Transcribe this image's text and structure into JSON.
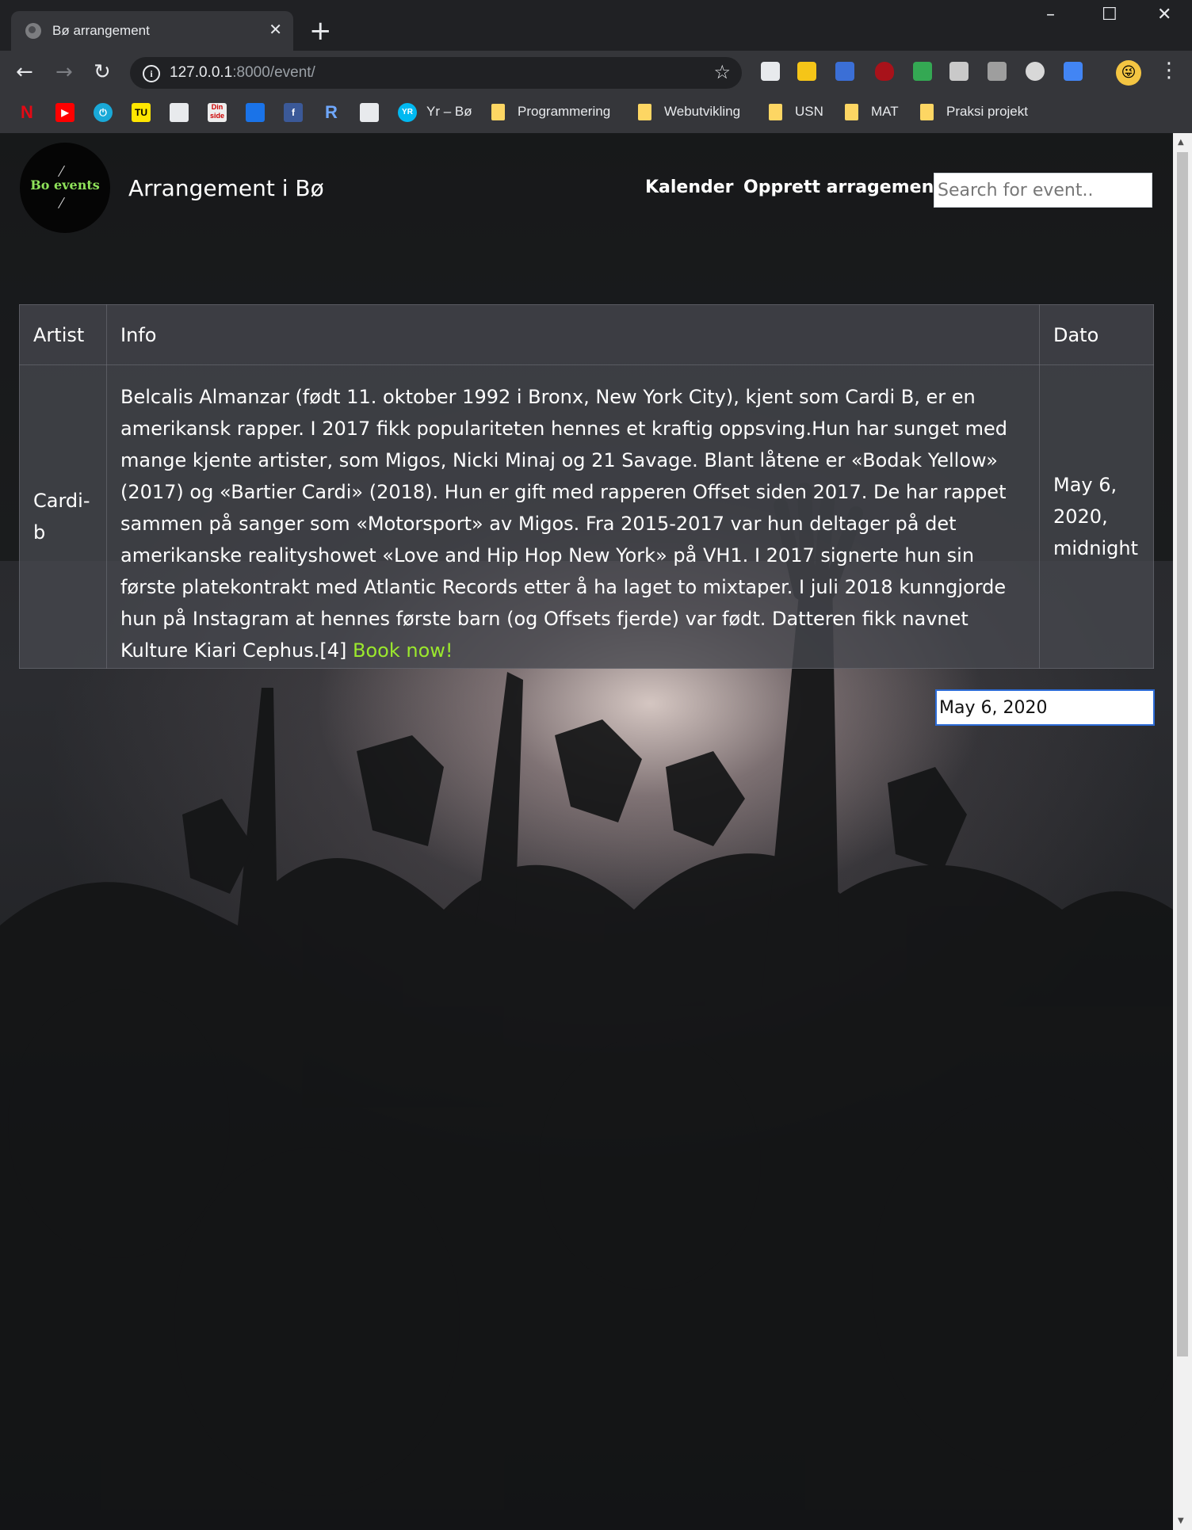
{
  "browser": {
    "tab_title": "Bø arrangement",
    "url_host": "127.0.0.1",
    "url_rest": ":8000/event/",
    "bookmarks": [
      {
        "label": "Yr – Bø"
      },
      {
        "label": "Programmering"
      },
      {
        "label": "Webutvikling"
      },
      {
        "label": "USN"
      },
      {
        "label": "MAT"
      },
      {
        "label": "Praksi projekt"
      }
    ]
  },
  "site": {
    "logo_text": "Bo events",
    "title": "Arrangement i Bø",
    "nav": {
      "calendar": "Kalender",
      "create": "Opprett arragement"
    },
    "search": {
      "placeholder": "Search for event.."
    }
  },
  "table": {
    "headers": {
      "artist": "Artist",
      "info": "Info",
      "date": "Dato"
    },
    "rows": [
      {
        "artist": "Cardi-b",
        "info": "Belcalis Almanzar (født 11. oktober 1992 i Bronx, New York City), kjent som Cardi B, er en amerikansk rapper. I 2017 fikk populariteten hennes et kraftig oppsving.Hun har sunget med mange kjente artister, som Migos, Nicki Minaj og 21 Savage. Blant låtene er «Bodak Yellow» (2017) og «Bartier Cardi» (2018). Hun er gift med rapperen Offset siden 2017. De har rappet sammen på sanger som «Motorsport» av Migos. Fra 2015-2017 var hun deltager på det amerikanske realityshowet «Love and Hip Hop New York» på VH1. I 2017 signerte hun sin første platekontrakt med Atlantic Records etter å ha laget to mixtaper. I juli 2018 kunngjorde hun på Instagram at hennes første barn (og Offsets fjerde) var født. Datteren fikk navnet Kulture Kiari Cephus.[4]",
        "book_link": "Book now!",
        "date": "May 6, 2020, midnight"
      }
    ]
  },
  "date_filter": {
    "value": "May 6, 2020"
  },
  "colors": {
    "book_link": "#9be82d",
    "logo_text": "#8fe25a",
    "focus_border": "#2c6bd6"
  }
}
